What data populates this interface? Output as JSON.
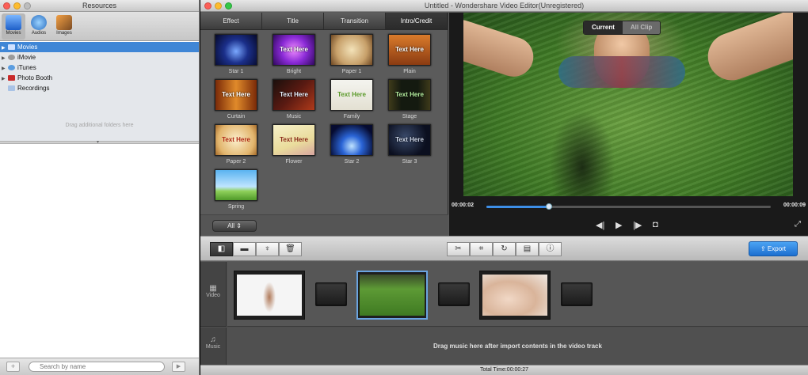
{
  "resources": {
    "title": "Resources",
    "tabs": [
      {
        "label": "Movies",
        "icon": "clapper-icon",
        "active": true
      },
      {
        "label": "Audios",
        "icon": "music-note-icon",
        "active": false
      },
      {
        "label": "Images",
        "icon": "photo-icon",
        "active": false
      }
    ],
    "tree": [
      {
        "label": "Movies",
        "selected": true,
        "expandable": true
      },
      {
        "label": "iMovie",
        "selected": false,
        "expandable": true
      },
      {
        "label": "iTunes",
        "selected": false,
        "expandable": true
      },
      {
        "label": "Photo Booth",
        "selected": false,
        "expandable": true
      },
      {
        "label": "Recordings",
        "selected": false,
        "expandable": false
      }
    ],
    "drag_hint": "Drag additional folders here",
    "add_label": "+",
    "next_label": "▶",
    "search_placeholder": "Search by name"
  },
  "window": {
    "title": "Untitled - Wondershare Video Editor(Unregistered)"
  },
  "library": {
    "tabs": [
      "Effect",
      "Title",
      "Transition",
      "Intro/Credit"
    ],
    "active_tab": "Intro/Credit",
    "items": [
      {
        "caption": "Star 1",
        "thumb_text": ""
      },
      {
        "caption": "Bright",
        "thumb_text": "Text Here"
      },
      {
        "caption": "Paper 1",
        "thumb_text": ""
      },
      {
        "caption": "Plain",
        "thumb_text": "Text Here"
      },
      {
        "caption": "Curtain",
        "thumb_text": "Text Here"
      },
      {
        "caption": "Music",
        "thumb_text": "Text Here"
      },
      {
        "caption": "Family",
        "thumb_text": "Text Here"
      },
      {
        "caption": "Stage",
        "thumb_text": "Text Here"
      },
      {
        "caption": "Paper 2",
        "thumb_text": "Text Here"
      },
      {
        "caption": "Flower",
        "thumb_text": "Text Here"
      },
      {
        "caption": "Star 2",
        "thumb_text": ""
      },
      {
        "caption": "Star 3",
        "thumb_text": "Text Here"
      },
      {
        "caption": "Spring",
        "thumb_text": ""
      }
    ],
    "filter_value": "All"
  },
  "preview": {
    "mode_current": "Current",
    "mode_all": "All Clip",
    "time_current": "00:00:02",
    "time_total": "00:00:09",
    "progress": 0.22
  },
  "toolbar": {
    "export_label": "Export"
  },
  "timeline": {
    "video_label": "Video",
    "music_label": "Music",
    "music_hint": "Drag music here after import contents in the video track"
  },
  "status": {
    "total_time": "Total Time:00:00:27"
  },
  "colors": {
    "accent": "#3d8ee6",
    "selection": "#3f86d6"
  }
}
